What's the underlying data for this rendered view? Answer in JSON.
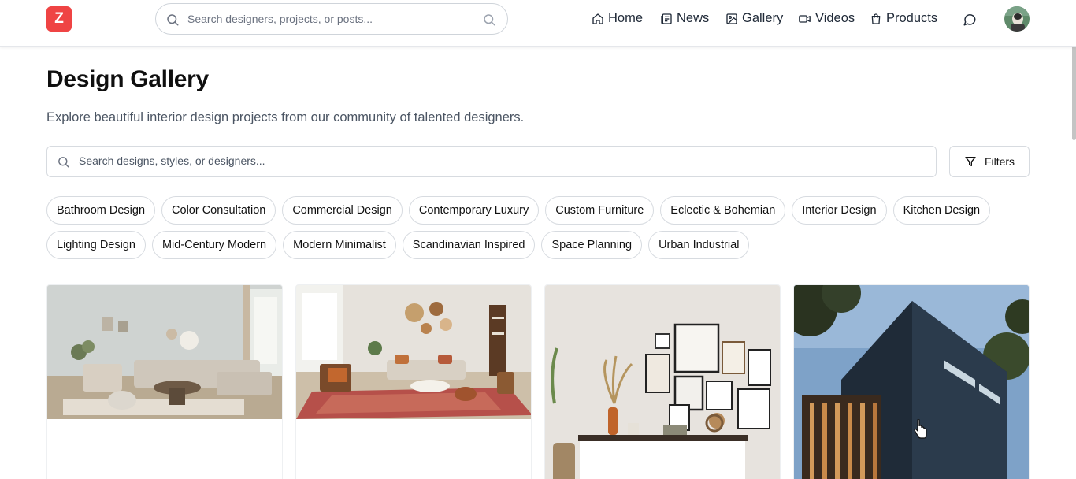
{
  "header": {
    "logo_letter": "Z",
    "search_placeholder": "Search designers, projects, or posts...",
    "nav": [
      {
        "label": "Home",
        "icon": "home-icon"
      },
      {
        "label": "News",
        "icon": "newspaper-icon"
      },
      {
        "label": "Gallery",
        "icon": "image-icon"
      },
      {
        "label": "Videos",
        "icon": "video-icon"
      },
      {
        "label": "Products",
        "icon": "shopping-bag-icon"
      }
    ],
    "messages_icon": "message-circle-icon",
    "avatar_icon": "user-avatar"
  },
  "page": {
    "title": "Design Gallery",
    "subtitle": "Explore beautiful interior design projects from our community of talented designers."
  },
  "search": {
    "placeholder": "Search designs, styles, or designers...",
    "filters_label": "Filters"
  },
  "tags": {
    "row1": [
      "Bathroom Design",
      "Color Consultation",
      "Commercial Design",
      "Contemporary Luxury",
      "Custom Furniture",
      "Eclectic & Bohemian",
      "Interior Design",
      "Kitchen Design"
    ],
    "row2": [
      "Lighting Design",
      "Mid-Century Modern",
      "Modern Minimalist",
      "Scandinavian Inspired",
      "Space Planning",
      "Urban Industrial"
    ]
  },
  "colors": {
    "brand": "#ef4444",
    "border": "#d7dbe0",
    "text_muted": "#4b5563"
  },
  "gallery": [
    {
      "image": "living-room-neutral-sofa"
    },
    {
      "image": "living-room-boho-rug"
    },
    {
      "image": "wall-gallery-sideboard"
    },
    {
      "image": "modern-dark-building-exterior"
    }
  ]
}
